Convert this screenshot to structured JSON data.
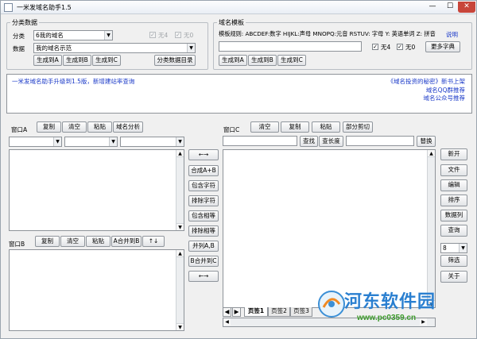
{
  "window": {
    "title": "一米发域名助手1.5",
    "min": "—",
    "max": "☐",
    "close": "✕"
  },
  "category_group": {
    "title": "分类数据",
    "category_label": "分类",
    "category_value": "6我的域名",
    "check4_label": "无4",
    "check0_label": "无0",
    "data_label": "数据",
    "data_value": "我的域名示范",
    "gen_a": "生成到A",
    "gen_b": "生成到B",
    "gen_c": "生成到C",
    "category_dir": "分类数据目录"
  },
  "template_group": {
    "title": "域名模板",
    "rules": "模板规则: ABCDEF:数字 HIJKL:声母 MNOPQ:元音 RSTUV: 字母 Y: 英语单词 Z: 拼音",
    "help_link": "说明",
    "template_value": "",
    "gen_a": "生成到A",
    "gen_b": "生成到B",
    "gen_c": "生成到C",
    "check4_label": "无4",
    "check0_label": "无0",
    "more_dict": "更多字典"
  },
  "notice": {
    "left": "一米发域名助手升级到1.5版，新增建站率查询",
    "right1": "《域名投资的秘密》新书上架",
    "right2": "域名QQ群推荐",
    "right3": "域名公众号推荐"
  },
  "window_a": {
    "label": "窗口A",
    "copy": "复制",
    "clear": "清空",
    "paste": "粘贴",
    "analyze": "域名分析",
    "filter1": "",
    "filter2": "",
    "filter3": ""
  },
  "window_b": {
    "label": "窗口B",
    "copy": "复制",
    "clear": "清空",
    "paste": "粘贴",
    "merge_ab": "A合并到B",
    "updown": "↑↓"
  },
  "middle": {
    "swap_top": "←→",
    "combine": "合成A+B",
    "contains": "包含字符",
    "excludes": "排除字符",
    "contains_same": "包含相等",
    "excludes_same": "排除相等",
    "join": "并列A,B",
    "merge_bc": "B合并到C",
    "swap_bottom": "←→"
  },
  "window_c": {
    "label": "窗口C",
    "clear": "清空",
    "copy": "复制",
    "paste": "粘贴",
    "cut_part": "部分剪切",
    "find_input": "",
    "find": "查找",
    "find_len": "查长度",
    "replace_input": "",
    "replace": "替换",
    "tabs": [
      "页签1",
      "页签2",
      "页签3"
    ]
  },
  "right_buttons": {
    "new": "新开",
    "file": "文件",
    "edit": "编辑",
    "sort": "排序",
    "data_col": "数据列",
    "query": "查询",
    "spin_value": "8",
    "filter": "筛选",
    "about": "关于"
  },
  "watermark": {
    "brand": "河东软件园",
    "url": "www.pc0359.cn"
  }
}
